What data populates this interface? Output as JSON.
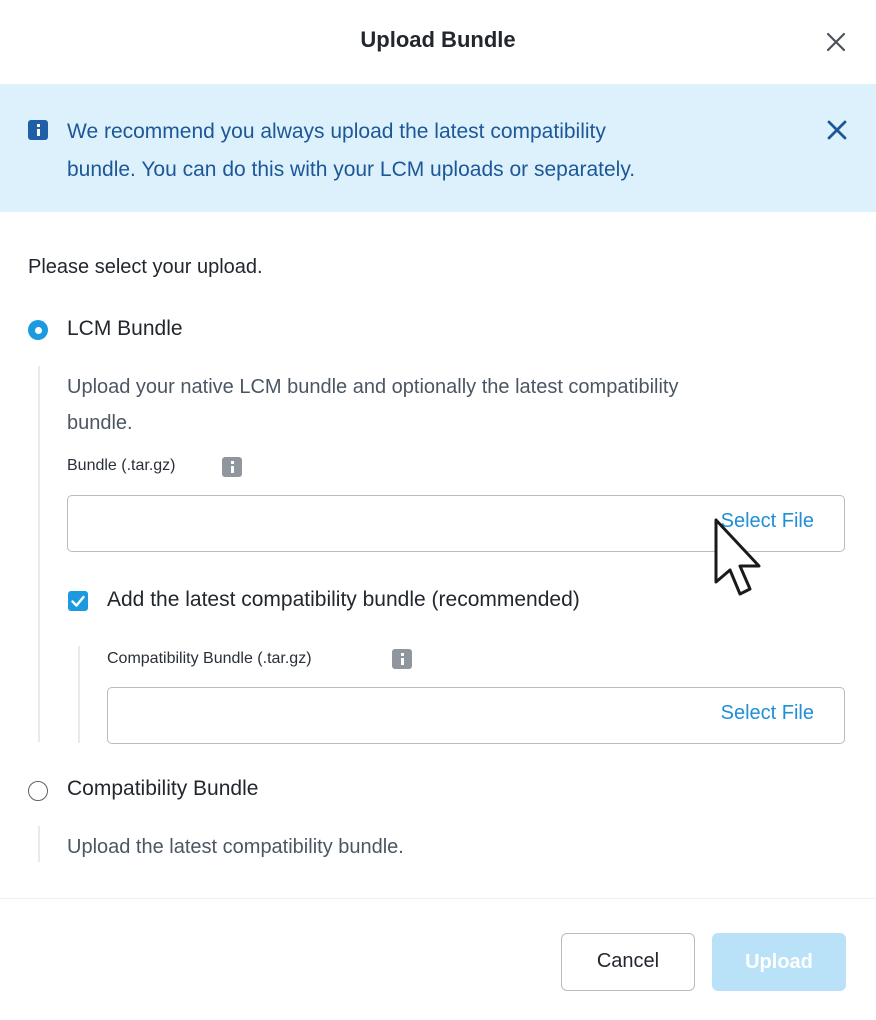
{
  "dialog": {
    "title": "Upload Bundle"
  },
  "banner": {
    "line1": "We recommend you always upload the latest compatibility",
    "line2": "bundle. You can do this with your LCM uploads or separately."
  },
  "prompt": "Please select your upload.",
  "options": {
    "lcm": {
      "label": "LCM Bundle",
      "selected": true,
      "desc_line1": "Upload your native LCM bundle and optionally the latest compatibility",
      "desc_line2": "bundle.",
      "field_label": "Bundle (.tar.gz)",
      "select_file": "Select File",
      "checkbox": {
        "label": "Add the latest compatibility bundle (recommended)",
        "checked": true,
        "field_label": "Compatibility Bundle (.tar.gz)",
        "select_file": "Select File"
      }
    },
    "compat": {
      "label": "Compatibility Bundle",
      "selected": false,
      "desc": "Upload the latest compatibility bundle."
    }
  },
  "footer": {
    "cancel": "Cancel",
    "upload": "Upload"
  },
  "colors": {
    "accent": "#1b9ae0",
    "banner_bg": "#dcf1fb",
    "banner_text": "#1e5797",
    "link": "#1f8fd6",
    "upload_disabled": "#b9e1f7"
  },
  "icons": {
    "dialog_close": "close-icon",
    "banner_info": "info-icon",
    "banner_close": "close-icon",
    "field_info": "info-icon",
    "checkbox": "checkmark-icon",
    "cursor": "mouse-pointer-icon"
  }
}
